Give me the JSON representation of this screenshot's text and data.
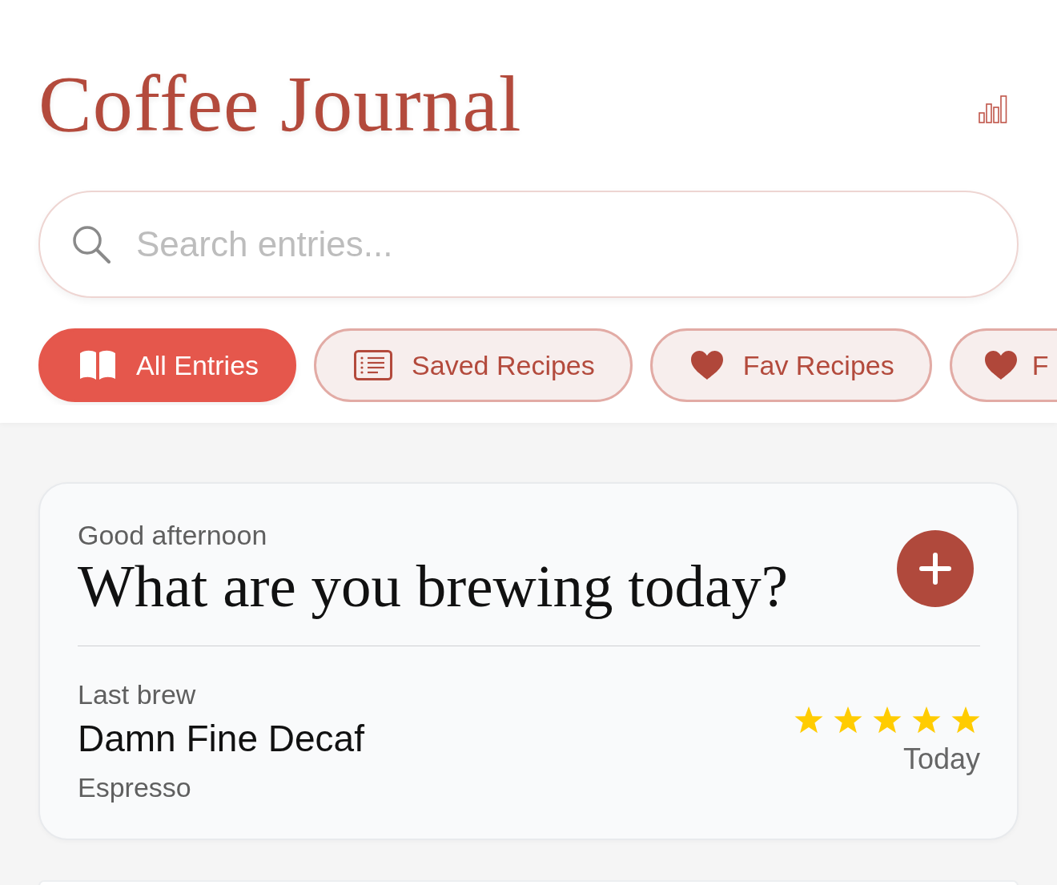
{
  "header": {
    "title": "Coffee Journal"
  },
  "search": {
    "placeholder": "Search entries..."
  },
  "filters": [
    {
      "label": "All Entries",
      "kind": "all",
      "selected": true
    },
    {
      "label": "Saved Recipes",
      "kind": "saved",
      "selected": false
    },
    {
      "label": "Fav Recipes",
      "kind": "favorite",
      "selected": false
    },
    {
      "label": "F",
      "kind": "favorite",
      "selected": false
    }
  ],
  "welcome": {
    "greeting": "Good afternoon",
    "prompt": "What are you brewing today?"
  },
  "last_brew": {
    "label": "Last brew",
    "name": "Damn Fine Decaf",
    "method": "Espresso",
    "stars": 5,
    "when": "Today"
  }
}
